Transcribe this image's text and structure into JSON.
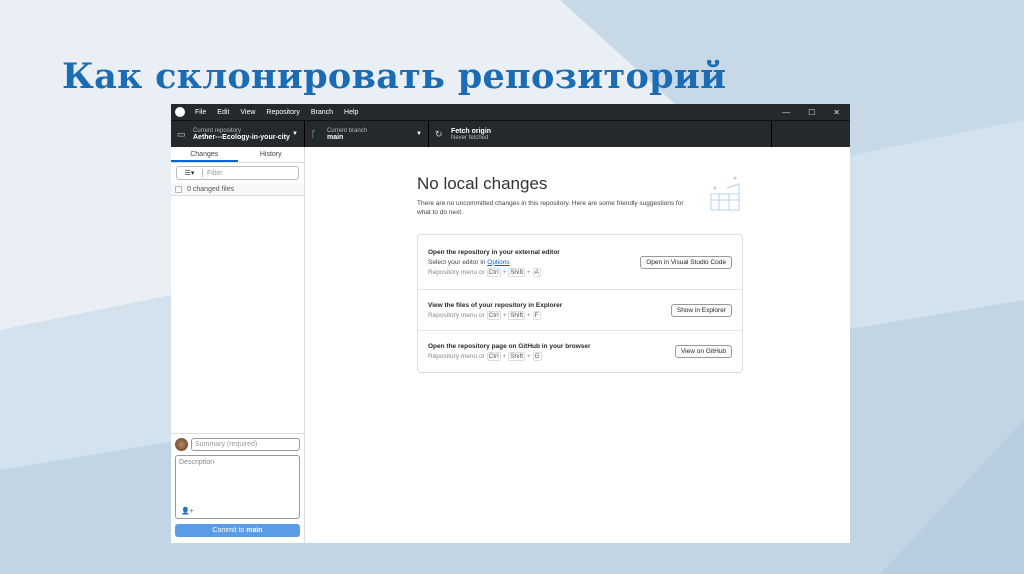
{
  "slide": {
    "title": "Как склонировать репозиторий"
  },
  "menu": [
    "File",
    "Edit",
    "View",
    "Repository",
    "Branch",
    "Help"
  ],
  "window_controls": {
    "minimize": "—",
    "maximize": "☐",
    "close": "✕"
  },
  "toolbar": {
    "repo": {
      "label": "Current repository",
      "value": "Aether---Ecology-in-your-city"
    },
    "branch": {
      "label": "Current branch",
      "value": "main"
    },
    "fetch": {
      "label": "Fetch origin",
      "value": "Never fetched"
    }
  },
  "sidebar": {
    "tabs": [
      "Changes",
      "History"
    ],
    "filter_placeholder": "Filter",
    "changed_files": "0 changed files",
    "summary_placeholder": "Summary (required)",
    "description_placeholder": "Description",
    "commit_prefix": "Commit to ",
    "commit_branch": "main"
  },
  "main": {
    "heading": "No local changes",
    "subtitle": "There are no uncommitted changes in this repository. Here are some friendly suggestions for what to do next.",
    "suggestions": [
      {
        "title": "Open the repository in your external editor",
        "desc_prefix": "Select your editor in ",
        "desc_link": "Options",
        "hint": "Repository menu or",
        "keys": [
          "Ctrl",
          "Shift",
          "A"
        ],
        "button": "Open in Visual Studio Code"
      },
      {
        "title": "View the files of your repository in Explorer",
        "hint": "Repository menu or",
        "keys": [
          "Ctrl",
          "Shift",
          "F"
        ],
        "button": "Show in Explorer"
      },
      {
        "title": "Open the repository page on GitHub in your browser",
        "hint": "Repository menu or",
        "keys": [
          "Ctrl",
          "Shift",
          "G"
        ],
        "button": "View on GitHub"
      }
    ]
  }
}
